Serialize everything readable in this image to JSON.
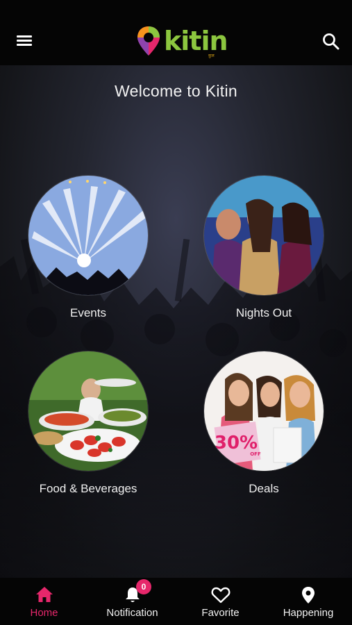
{
  "app": {
    "brand": "kitin",
    "brand_sub": "कुल"
  },
  "header": {
    "menu_icon": "hamburger-icon",
    "search_icon": "search-icon"
  },
  "welcome": "Welcome to Kitin",
  "tiles": [
    {
      "label": "Events"
    },
    {
      "label": "Nights Out"
    },
    {
      "label": "Food & Beverages"
    },
    {
      "label": "Deals",
      "promo_text": "30%",
      "promo_sub": "OFF"
    }
  ],
  "nav": [
    {
      "label": "Home",
      "icon": "home-icon",
      "active": true
    },
    {
      "label": "Notification",
      "icon": "bell-icon",
      "badge": "0"
    },
    {
      "label": "Favorite",
      "icon": "heart-icon"
    },
    {
      "label": "Happening",
      "icon": "map-pin-icon"
    }
  ],
  "colors": {
    "accent": "#e6276b",
    "brand_green": "#8cc63f",
    "bar_bg": "#050505"
  }
}
